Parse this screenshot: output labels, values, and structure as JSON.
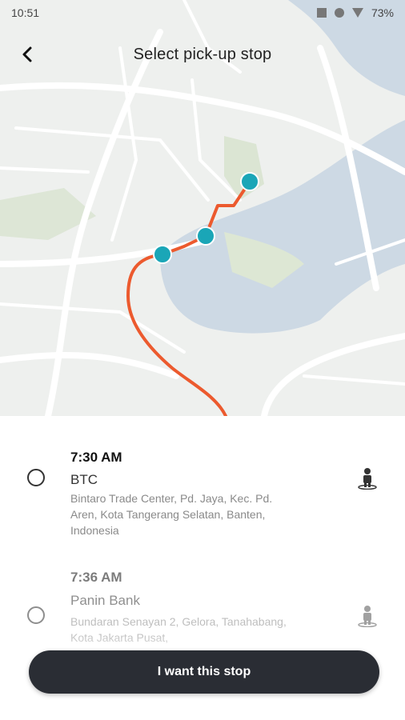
{
  "status_bar": {
    "time": "10:51",
    "battery": "73%"
  },
  "header": {
    "title": "Select pick-up stop"
  },
  "colors": {
    "route": "#ec5a2e",
    "stop_marker": "#1aa6b7",
    "cta_bg": "#2a2d34"
  },
  "stops": [
    {
      "time": "7:30 AM",
      "name": "BTC",
      "address": "Bintaro Trade Center, Pd. Jaya, Kec. Pd. Aren, Kota Tangerang Selatan, Banten, Indonesia",
      "icon": "person-standing-icon"
    },
    {
      "time": "7:36 AM",
      "name": "Panin Bank",
      "address": "Bundaran Senayan 2, Gelora, Tanahabang, Kota Jakarta Pusat,",
      "icon": "person-standing-icon"
    }
  ],
  "cta": {
    "label": "I want this stop"
  }
}
